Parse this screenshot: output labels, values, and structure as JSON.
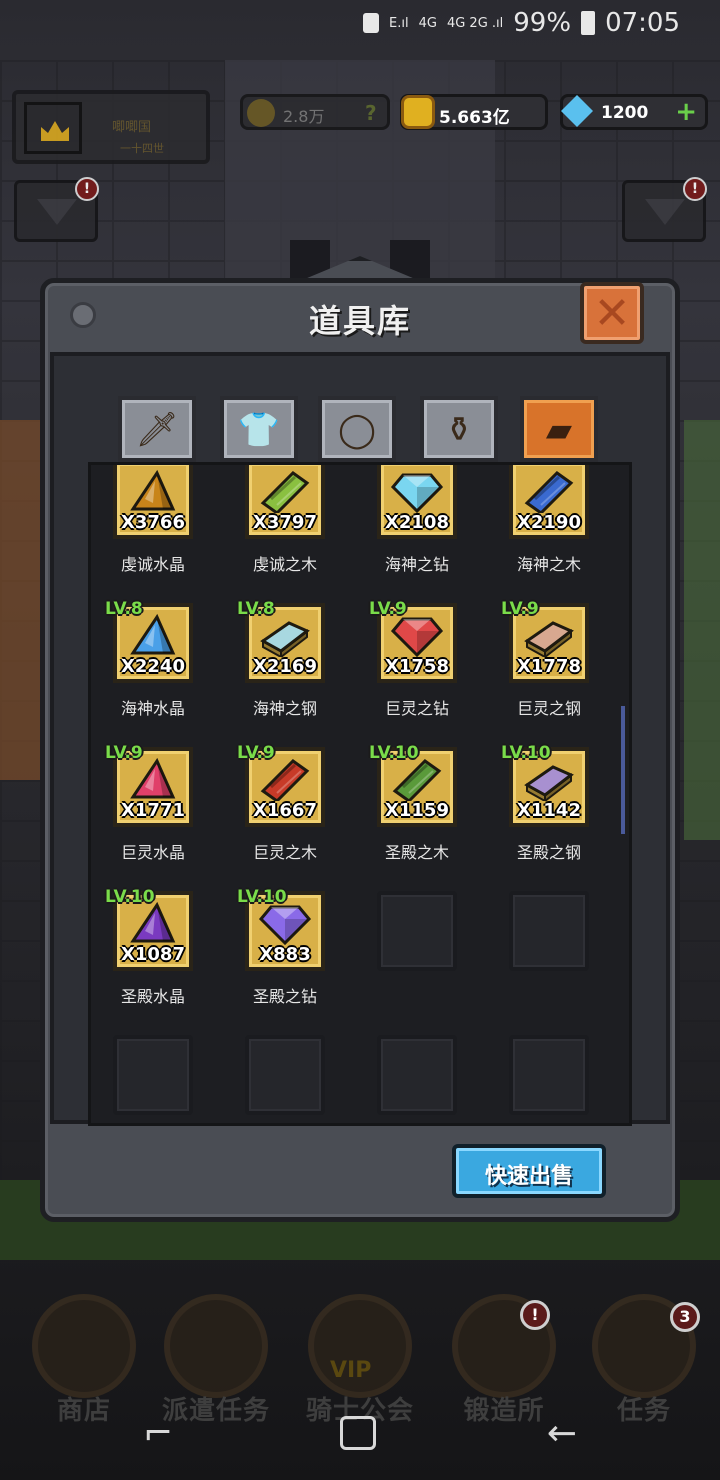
{
  "status_bar": {
    "signal_1": "E.ıl",
    "signal_2": "4G",
    "signal_3": "4G 2G .ıl",
    "battery": "99%",
    "time": "07:05"
  },
  "hud": {
    "kingdom_name": "唧唧国",
    "kingdom_sub": "一十四世",
    "power_value": "2.8万",
    "power_help": "?",
    "gold_value": "5.663亿",
    "gem_value": "1200",
    "gem_add": "+",
    "left_badge": "!",
    "right_badge": "!"
  },
  "panel": {
    "title": "道具库",
    "close_label": "✕",
    "sell_button": "快速出售"
  },
  "tabs": [
    {
      "name": "weapons",
      "icon": "sword-icon",
      "glyph": "🗡"
    },
    {
      "name": "armor",
      "icon": "armor-icon",
      "glyph": "👕"
    },
    {
      "name": "accessories",
      "icon": "ring-icon",
      "glyph": "◯"
    },
    {
      "name": "potions",
      "icon": "potion-icon",
      "glyph": "⚱"
    },
    {
      "name": "materials",
      "icon": "log-icon",
      "glyph": "▰"
    }
  ],
  "items": [
    {
      "level": "",
      "count": "X3766",
      "name": "虔诚水晶",
      "color": "#c8841a",
      "shape": "crystal"
    },
    {
      "level": "",
      "count": "X3797",
      "name": "虔诚之木",
      "color": "#8ac040",
      "shape": "wood"
    },
    {
      "level": "",
      "count": "X2108",
      "name": "海神之钻",
      "color": "#7ad6f0",
      "shape": "gem"
    },
    {
      "level": "",
      "count": "X2190",
      "name": "海神之木",
      "color": "#3a6ad0",
      "shape": "wood"
    },
    {
      "level": "LV.8",
      "count": "X2240",
      "name": "海神水晶",
      "color": "#4aa0e8",
      "shape": "crystal"
    },
    {
      "level": "LV.8",
      "count": "X2169",
      "name": "海神之钢",
      "color": "#a8d8e0",
      "shape": "bar"
    },
    {
      "level": "LV.9",
      "count": "X1758",
      "name": "巨灵之钻",
      "color": "#e04848",
      "shape": "gem"
    },
    {
      "level": "LV.9",
      "count": "X1778",
      "name": "巨灵之钢",
      "color": "#d8a890",
      "shape": "bar"
    },
    {
      "level": "LV.9",
      "count": "X1771",
      "name": "巨灵水晶",
      "color": "#e0406a",
      "shape": "crystal"
    },
    {
      "level": "LV.9",
      "count": "X1667",
      "name": "巨灵之木",
      "color": "#c83a28",
      "shape": "wood"
    },
    {
      "level": "LV.10",
      "count": "X1159",
      "name": "圣殿之木",
      "color": "#5a9a3a",
      "shape": "wood"
    },
    {
      "level": "LV.10",
      "count": "X1142",
      "name": "圣殿之钢",
      "color": "#a890d0",
      "shape": "bar"
    },
    {
      "level": "LV.10",
      "count": "X1087",
      "name": "圣殿水晶",
      "color": "#7a3ac0",
      "shape": "crystal"
    },
    {
      "level": "LV.10",
      "count": "X883",
      "name": "圣殿之钻",
      "color": "#8a6ae8",
      "shape": "gem"
    }
  ],
  "bottom_nav": [
    {
      "label": "商店",
      "icon": "shop-icon",
      "badge": ""
    },
    {
      "label": "派遣任务",
      "icon": "dispatch-icon",
      "badge": ""
    },
    {
      "label": "骑士公会",
      "icon": "knight-helmet-icon",
      "badge": "",
      "vip": "VIP"
    },
    {
      "label": "锻造所",
      "icon": "anvil-icon",
      "badge": "!"
    },
    {
      "label": "任务",
      "icon": "scroll-icon",
      "badge": "3"
    }
  ],
  "android_nav": {
    "recent": "⌐",
    "back": "←"
  }
}
